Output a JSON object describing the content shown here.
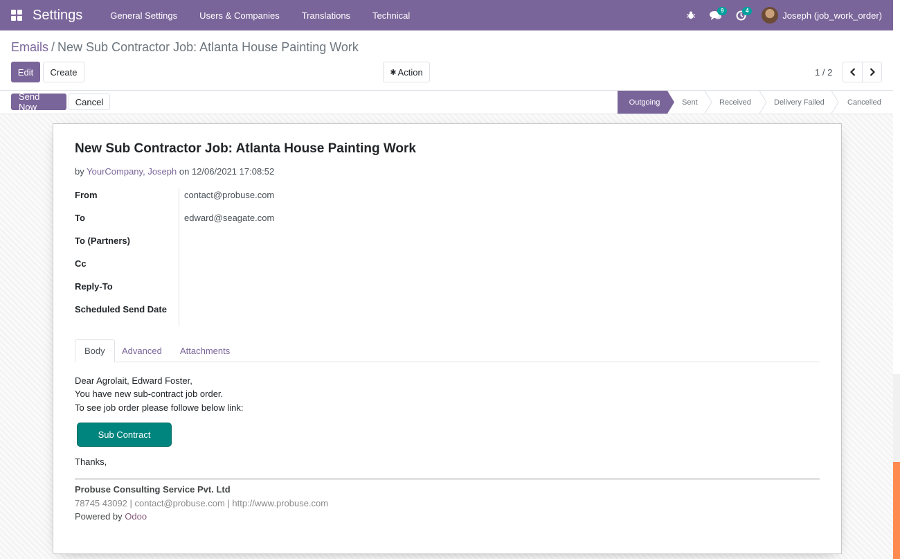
{
  "navbar": {
    "app_title": "Settings",
    "menu": [
      "General Settings",
      "Users & Companies",
      "Translations",
      "Technical"
    ],
    "messages_count": "9",
    "activities_count": "4",
    "user": "Joseph (job_work_order)"
  },
  "breadcrumb": {
    "parent": "Emails",
    "separator": "/",
    "current": "New Sub Contractor Job: Atlanta House Painting Work"
  },
  "buttons": {
    "edit": "Edit",
    "create": "Create",
    "action": "Action",
    "send_now": "Send Now",
    "cancel": "Cancel"
  },
  "pager": {
    "value": "1 / 2"
  },
  "statusbar": {
    "stages": [
      "Outgoing",
      "Sent",
      "Received",
      "Delivery Failed",
      "Cancelled"
    ],
    "active": "Outgoing"
  },
  "email": {
    "subject": "New Sub Contractor Job: Atlanta House Painting Work",
    "by_prefix": "by",
    "author_company": "YourCompany",
    "author_sep": ",",
    "author_name": "Joseph",
    "date_prefix": "on",
    "date": "12/06/2021 17:08:52",
    "fields": [
      {
        "label": "From",
        "value": "contact@probuse.com"
      },
      {
        "label": "To",
        "value": "edward@seagate.com"
      },
      {
        "label": "To (Partners)",
        "value": ""
      },
      {
        "label": "Cc",
        "value": ""
      },
      {
        "label": "Reply-To",
        "value": ""
      },
      {
        "label": "Scheduled Send Date",
        "value": ""
      }
    ]
  },
  "tabs": [
    "Body",
    "Advanced",
    "Attachments"
  ],
  "body": {
    "lines": [
      "Dear Agrolait, Edward Foster,",
      "You have new sub-contract job order.",
      "To see job order please followe below link:"
    ],
    "cta": "Sub Contract",
    "closing": "Thanks,",
    "company": "Probuse Consulting Service Pvt. Ltd",
    "contact": "78745 43092 | contact@probuse.com | http://www.probuse.com",
    "powered_prefix": "Powered by",
    "powered_link": "Odoo"
  },
  "colors": {
    "brand": "#7a659a",
    "teal": "#00857e"
  }
}
